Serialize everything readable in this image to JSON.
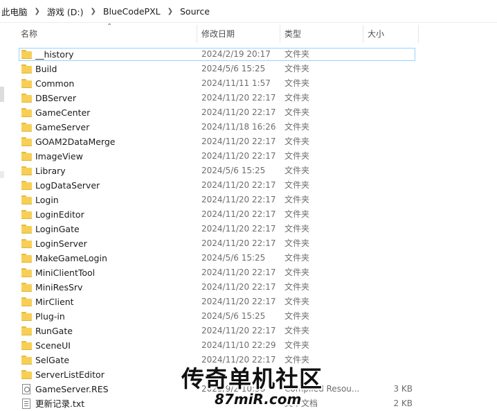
{
  "breadcrumb": [
    "此电脑",
    "游戏 (D:)",
    "BlueCodePXL",
    "Source"
  ],
  "columns": {
    "name": "名称",
    "date": "修改日期",
    "type": "类型",
    "size": "大小"
  },
  "files": [
    {
      "name": "__history",
      "date": "2024/2/19 20:17",
      "type": "文件夹",
      "size": "",
      "icon": "folder-icon"
    },
    {
      "name": "Build",
      "date": "2024/5/6 15:25",
      "type": "文件夹",
      "size": "",
      "icon": "folder-icon"
    },
    {
      "name": "Common",
      "date": "2024/11/11 1:57",
      "type": "文件夹",
      "size": "",
      "icon": "folder-icon"
    },
    {
      "name": "DBServer",
      "date": "2024/11/20 22:17",
      "type": "文件夹",
      "size": "",
      "icon": "folder-icon"
    },
    {
      "name": "GameCenter",
      "date": "2024/11/20 22:17",
      "type": "文件夹",
      "size": "",
      "icon": "folder-icon"
    },
    {
      "name": "GameServer",
      "date": "2024/11/18 16:26",
      "type": "文件夹",
      "size": "",
      "icon": "folder-icon"
    },
    {
      "name": "GOAM2DataMerge",
      "date": "2024/11/20 22:17",
      "type": "文件夹",
      "size": "",
      "icon": "folder-icon"
    },
    {
      "name": "ImageView",
      "date": "2024/11/20 22:17",
      "type": "文件夹",
      "size": "",
      "icon": "folder-icon"
    },
    {
      "name": "Library",
      "date": "2024/5/6 15:25",
      "type": "文件夹",
      "size": "",
      "icon": "folder-icon"
    },
    {
      "name": "LogDataServer",
      "date": "2024/11/20 22:17",
      "type": "文件夹",
      "size": "",
      "icon": "folder-icon"
    },
    {
      "name": "Login",
      "date": "2024/11/20 22:17",
      "type": "文件夹",
      "size": "",
      "icon": "folder-icon"
    },
    {
      "name": "LoginEditor",
      "date": "2024/11/20 22:17",
      "type": "文件夹",
      "size": "",
      "icon": "folder-icon"
    },
    {
      "name": "LoginGate",
      "date": "2024/11/20 22:17",
      "type": "文件夹",
      "size": "",
      "icon": "folder-icon"
    },
    {
      "name": "LoginServer",
      "date": "2024/11/20 22:17",
      "type": "文件夹",
      "size": "",
      "icon": "folder-icon"
    },
    {
      "name": "MakeGameLogin",
      "date": "2024/5/6 15:25",
      "type": "文件夹",
      "size": "",
      "icon": "folder-icon"
    },
    {
      "name": "MiniClientTool",
      "date": "2024/11/20 22:17",
      "type": "文件夹",
      "size": "",
      "icon": "folder-icon"
    },
    {
      "name": "MiniResSrv",
      "date": "2024/11/20 22:17",
      "type": "文件夹",
      "size": "",
      "icon": "folder-icon"
    },
    {
      "name": "MirClient",
      "date": "2024/11/20 22:17",
      "type": "文件夹",
      "size": "",
      "icon": "folder-icon"
    },
    {
      "name": "Plug-in",
      "date": "2024/5/6 15:25",
      "type": "文件夹",
      "size": "",
      "icon": "folder-icon"
    },
    {
      "name": "RunGate",
      "date": "2024/11/20 22:17",
      "type": "文件夹",
      "size": "",
      "icon": "folder-icon"
    },
    {
      "name": "SceneUI",
      "date": "2024/11/10 22:29",
      "type": "文件夹",
      "size": "",
      "icon": "folder-icon"
    },
    {
      "name": "SelGate",
      "date": "2024/11/20 22:17",
      "type": "文件夹",
      "size": "",
      "icon": "folder-icon"
    },
    {
      "name": "ServerListEditor",
      "date": "",
      "type": "",
      "size": "",
      "icon": "folder-icon"
    },
    {
      "name": "GameServer.RES",
      "date": "2025/9/2 10:38",
      "type": "Compiled Resou...",
      "size": "3 KB",
      "icon": "res-file-icon"
    },
    {
      "name": "更新记录.txt",
      "date": "",
      "type": "文本文档",
      "size": "2 KB",
      "icon": "text-file-icon"
    }
  ],
  "watermark": {
    "main": "传奇单机社区",
    "sub": "87miR.com"
  },
  "colors": {
    "folder": "#f7cf55",
    "selection_border": "#99d1ff",
    "secondary_text": "#6d6d6d"
  }
}
